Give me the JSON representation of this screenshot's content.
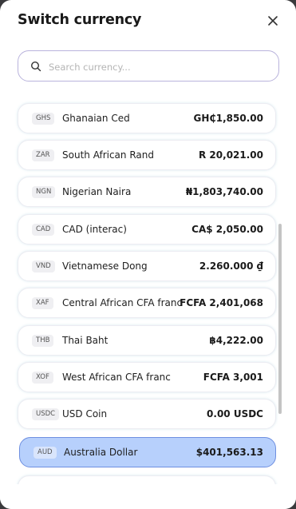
{
  "modal": {
    "title": "Switch currency"
  },
  "search": {
    "placeholder": "Search currency..."
  },
  "currencies": [
    {
      "code": "GHS",
      "name": "Ghanaian Ced",
      "amount": "GH₵1,850.00"
    },
    {
      "code": "ZAR",
      "name": "South African Rand",
      "amount": "R 20,021.00"
    },
    {
      "code": "NGN",
      "name": "Nigerian Naira",
      "amount": "₦1,803,740.00"
    },
    {
      "code": "CAD",
      "name": "CAD (interac)",
      "amount": "CA$ 2,050.00"
    },
    {
      "code": "VND",
      "name": "Vietnamese Dong",
      "amount": "2.260.000 ₫"
    },
    {
      "code": "XAF",
      "name": "Central African CFA franc",
      "amount": "FCFA 2,401,068"
    },
    {
      "code": "THB",
      "name": "Thai Baht",
      "amount": "฿4,222.00"
    },
    {
      "code": "XOF",
      "name": "West African CFA franc",
      "amount": "FCFA 3,001"
    },
    {
      "code": "USDC",
      "name": "USD Coin",
      "amount": "0.00 USDC"
    },
    {
      "code": "AUD",
      "name": "Australia Dollar",
      "amount": "$401,563.13",
      "selected": true
    }
  ],
  "colors": {
    "selected_bg": "#b7d0fc",
    "selected_border": "#6e8fe0",
    "search_border": "#b9b3dc"
  }
}
